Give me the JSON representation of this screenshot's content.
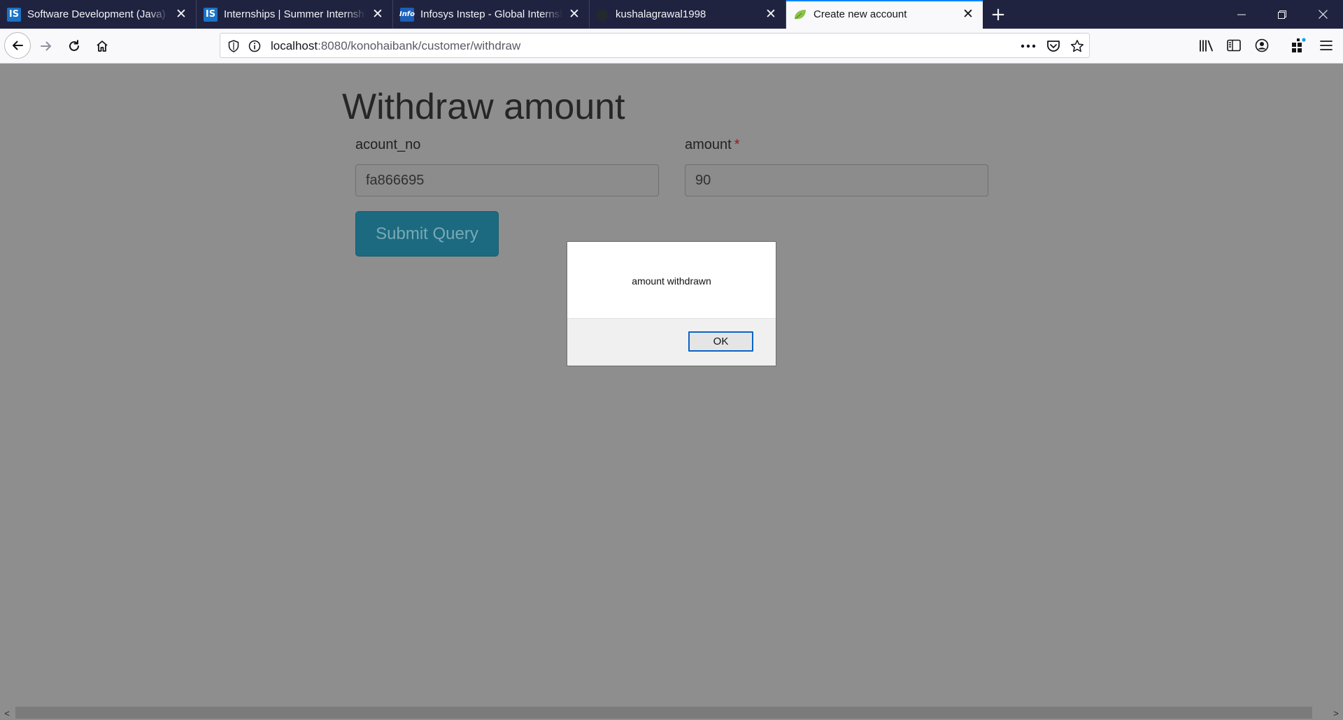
{
  "browser": {
    "tabs": [
      {
        "title": "Software Development (Java) w",
        "favicon": "is-icon",
        "favicon_text": "IS",
        "active": false
      },
      {
        "title": "Internships | Summer Internships",
        "favicon": "is-icon",
        "favicon_text": "IS",
        "active": false
      },
      {
        "title": "Infosys Instep - Global Internship",
        "favicon": "infosys-icon",
        "favicon_text": "Info",
        "active": false
      },
      {
        "title": "kushalagrawal1998",
        "favicon": "github-icon",
        "favicon_text": "",
        "active": false
      },
      {
        "title": "Create new account",
        "favicon": "spring-leaf-icon",
        "favicon_text": "",
        "active": true
      }
    ],
    "close_glyph": "✕",
    "newtab_glyph": "+",
    "window_controls": {
      "minimize": "—",
      "restore": "❐",
      "close": "✕"
    },
    "url": {
      "host": "localhost",
      "path": ":8080/konohaibank/customer/withdraw"
    },
    "accent_color": "#0a84ff",
    "tabstrip_color": "#202340"
  },
  "page": {
    "title": "Withdraw amount",
    "fields": {
      "account_no": {
        "label": "acount_no",
        "value": "fa866695"
      },
      "amount": {
        "label": "amount",
        "required_mark": "*",
        "value": "90"
      }
    },
    "submit_label": "Submit Query",
    "submit_color": "#1b6a80"
  },
  "alert": {
    "message": "amount withdrawn",
    "ok_label": "OK"
  },
  "scrollbar": {
    "left_arrow": "<",
    "right_arrow": ">"
  }
}
